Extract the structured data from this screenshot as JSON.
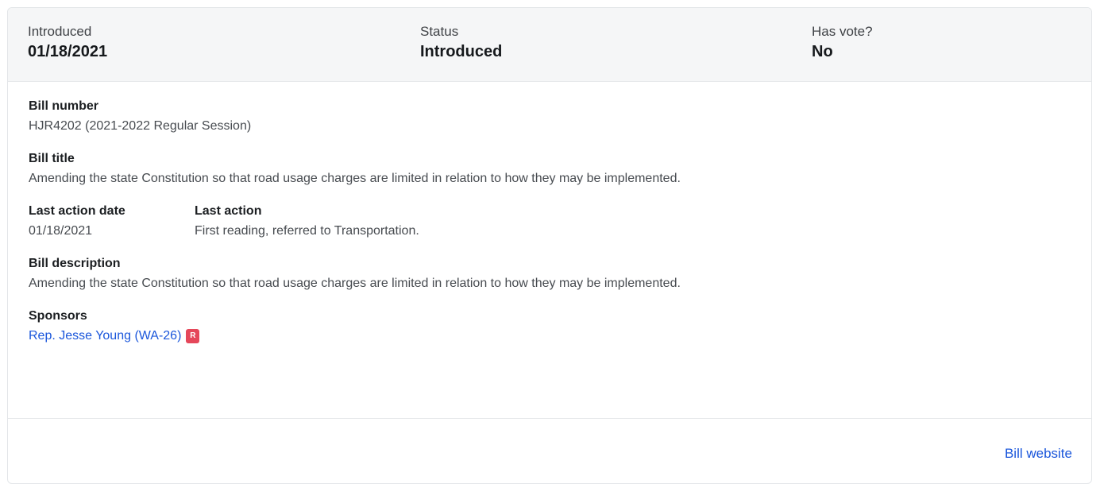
{
  "summary": {
    "introduced_label": "Introduced",
    "introduced_value": "01/18/2021",
    "status_label": "Status",
    "status_value": "Introduced",
    "vote_label": "Has vote?",
    "vote_value": "No"
  },
  "bill_number": {
    "label": "Bill number",
    "value": "HJR4202 (2021-2022 Regular Session)"
  },
  "bill_title": {
    "label": "Bill title",
    "value": "Amending the state Constitution so that road usage charges are limited in relation to how they may be implemented."
  },
  "last_action": {
    "date_label": "Last action date",
    "date_value": "01/18/2021",
    "action_label": "Last action",
    "action_value": "First reading, referred to Transportation."
  },
  "bill_description": {
    "label": "Bill description",
    "value": "Amending the state Constitution so that road usage charges are limited in relation to how they may be implemented."
  },
  "sponsors": {
    "label": "Sponsors",
    "items": [
      {
        "name": "Rep. Jesse Young (WA-26)",
        "party": "R",
        "party_color": "#e5475a"
      }
    ]
  },
  "footer": {
    "bill_website_label": "Bill website"
  },
  "colors": {
    "link": "#1a56db",
    "summary_bg": "#f5f6f7"
  }
}
